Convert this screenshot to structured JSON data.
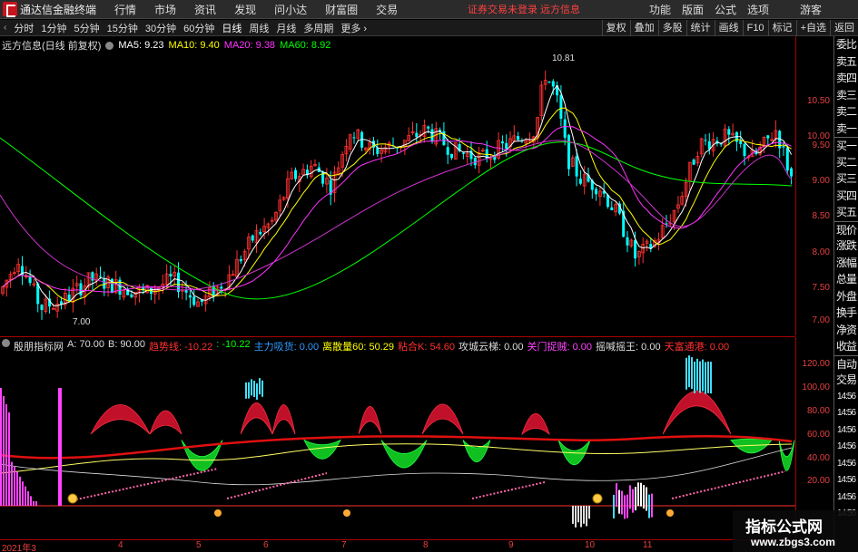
{
  "app": {
    "title": "通达信金融终端",
    "menu": [
      "行情",
      "市场",
      "资讯",
      "发现",
      "问小达",
      "财富圈",
      "交易"
    ],
    "notice": "证券交易未登录  远方信息",
    "right_menu": [
      "功能",
      "版面",
      "公式",
      "选项"
    ],
    "user": "游客",
    "win_buttons": [
      "▣",
      "─",
      "□",
      "✕"
    ]
  },
  "toolbar": {
    "periods": [
      "分时",
      "1分钟",
      "5分钟",
      "15分钟",
      "30分钟",
      "60分钟",
      "日线",
      "周线",
      "月线",
      "多周期",
      "更多 ›"
    ],
    "active_period": "日线",
    "right_tools": [
      "复权",
      "叠加",
      "多股",
      "统计",
      "画线",
      "F10",
      "标记",
      "+自选",
      "返回"
    ]
  },
  "main_chart": {
    "name": "远方信息(日线 前复权)",
    "ma": [
      {
        "label": "MA5: 9.23",
        "color": "#ffffff"
      },
      {
        "label": "MA10: 9.40",
        "color": "#ffff00"
      },
      {
        "label": "MA20: 9.38",
        "color": "#ff33ff"
      },
      {
        "label": "MA60: 8.92",
        "color": "#00ff00"
      }
    ],
    "high_label": "10.81",
    "low_label": "7.00",
    "y_ticks": [
      "10.50",
      "10.00",
      "9.50",
      "9.00",
      "8.50",
      "8.00",
      "7.50",
      "7.00"
    ]
  },
  "indicator": {
    "name": "殷朋指标网",
    "items": [
      {
        "label": "A: 70.00",
        "color": "#dddddd"
      },
      {
        "label": "B: 90.00",
        "color": "#dddddd"
      },
      {
        "label": "趋势线: -10.22",
        "color": "#ff3030"
      },
      {
        "label": ": -10.22",
        "color": "#00ff00"
      },
      {
        "label": "主力吸货: 0.00",
        "color": "#2f9bff"
      },
      {
        "label": "离散量60: 50.29",
        "color": "#ffff00"
      },
      {
        "label": "粘合K: 54.60",
        "color": "#ff3030"
      },
      {
        "label": "攻城云梯: 0.00",
        "color": "#dddddd"
      },
      {
        "label": "关门捉贼: 0.00",
        "color": "#ff44ff"
      },
      {
        "label": "摇喊摇王: 0.00",
        "color": "#dddddd"
      },
      {
        "label": "天富通港: 0.00",
        "color": "#ff3030"
      }
    ],
    "y_ticks": [
      "120.00",
      "100.00",
      "80.00",
      "60.00",
      "40.00",
      "20.00"
    ]
  },
  "date_axis": [
    "2021年3",
    "4",
    "5",
    "6",
    "7",
    "8",
    "9",
    "10",
    "11"
  ],
  "side_panel": [
    "委比",
    "卖五",
    "卖四",
    "卖三",
    "卖二",
    "卖一",
    "买一",
    "买二",
    "买三",
    "买四",
    "买五",
    "现价",
    "涨跌",
    "涨幅",
    "总量",
    "外盘",
    "换手",
    "净资",
    "收益",
    "自动",
    "交易",
    "14:56",
    "14:56",
    "14:56",
    "14:56",
    "14:56",
    "14:56",
    "14:56",
    "14:56"
  ],
  "watermark": {
    "line1": "指标公式网",
    "line2": "www.zbgs3.com"
  },
  "colors": {
    "up": "#ff3030",
    "down": "#00ffff",
    "axis": "#e64040"
  }
}
